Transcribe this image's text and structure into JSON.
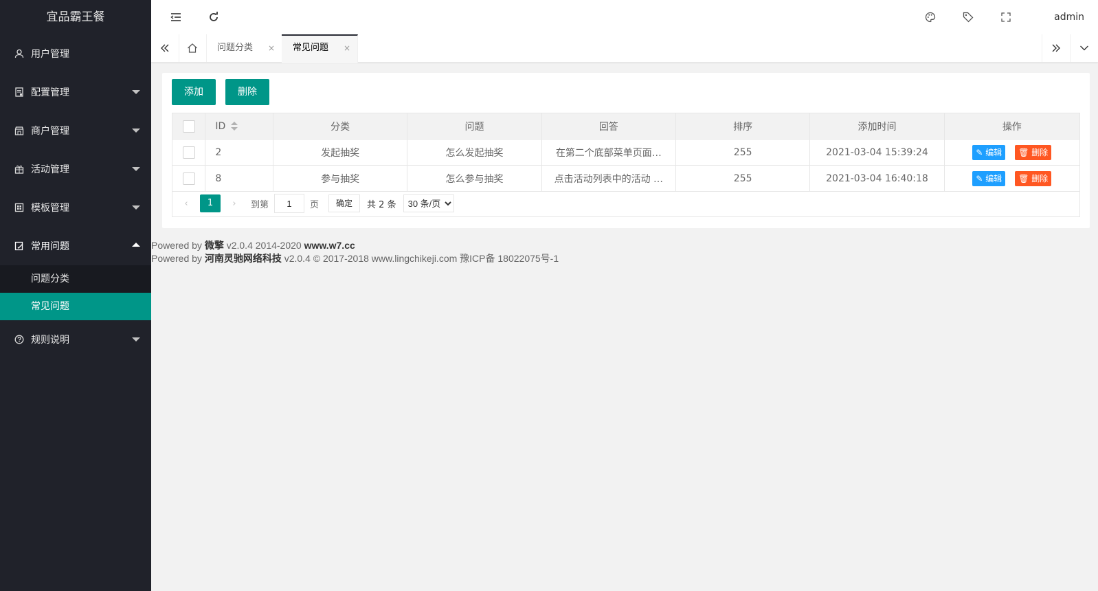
{
  "app": {
    "title": "宜品霸王餐"
  },
  "sidebar": {
    "items": [
      {
        "label": "用户管理",
        "icon": "user-icon"
      },
      {
        "label": "配置管理",
        "icon": "config-icon"
      },
      {
        "label": "商户管理",
        "icon": "store-icon"
      },
      {
        "label": "活动管理",
        "icon": "gift-icon"
      },
      {
        "label": "模板管理",
        "icon": "template-icon"
      },
      {
        "label": "常用问题",
        "icon": "edit-note-icon"
      },
      {
        "label": "规则说明",
        "icon": "help-circle-icon"
      }
    ],
    "subitems": [
      {
        "label": "问题分类"
      },
      {
        "label": "常见问题",
        "active": true
      }
    ]
  },
  "header": {
    "user": "admin",
    "icons": [
      "menu-fold-icon",
      "refresh-icon",
      "palette-icon",
      "tag-icon",
      "fullscreen-icon"
    ]
  },
  "tabs": {
    "items": [
      {
        "label": "问题分类"
      },
      {
        "label": "常见问题",
        "active": true
      }
    ],
    "close_glyph": "×"
  },
  "toolbar": {
    "add_label": "添加",
    "delete_label": "删除"
  },
  "table": {
    "headers": [
      "ID",
      "分类",
      "问题",
      "回答",
      "排序",
      "添加时间",
      "操作"
    ],
    "rows": [
      {
        "id": "2",
        "category": "发起抽奖",
        "question": "怎么发起抽奖",
        "answer": "在第二个底部菜单页面…",
        "sort": "255",
        "time": "2021-03-04 15:39:24"
      },
      {
        "id": "8",
        "category": "参与抽奖",
        "question": "怎么参与抽奖",
        "answer": "点击活动列表中的活动 …",
        "sort": "255",
        "time": "2021-03-04 16:40:18"
      }
    ],
    "edit_label": "编辑",
    "delete_label": "删除"
  },
  "pager": {
    "current": "1",
    "goto_label": "到第",
    "goto_value": "1",
    "page_unit": "页",
    "ok_label": "确定",
    "total": "共 2 条",
    "page_size": "30 条/页"
  },
  "footer": {
    "line1_prefix": "Powered by ",
    "line1_brand": "微擎",
    "line1_mid": " v2.0.4 2014-2020 ",
    "line1_site": "www.w7.cc",
    "line2_prefix": "Powered by ",
    "line2_brand": "河南灵驰网络科技",
    "line2_rest": " v2.0.4 © 2017-2018 www.lingchikeji.com 豫ICP备 18022075号-1"
  },
  "colors": {
    "primary": "#009688",
    "sidebar": "#20222a",
    "edit": "#1e9fff",
    "danger": "#ff5722"
  }
}
